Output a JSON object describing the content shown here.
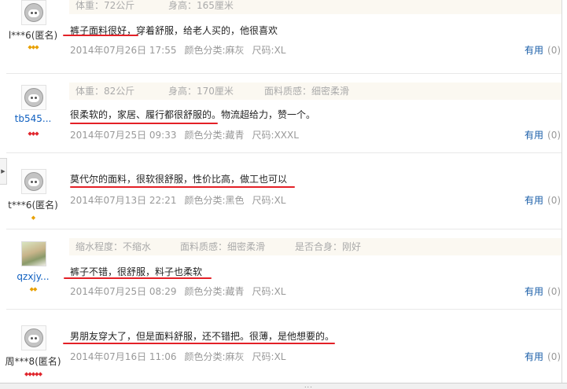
{
  "reviews": [
    {
      "user": "l***6(匿名)",
      "props": [
        "体重：72公斤",
        "身高：165厘米"
      ],
      "text": "裤子面料很好，穿着舒服，给老人买的，他很喜欢",
      "date": "2014年07月26日 17:55",
      "color": "颜色分类:麻灰",
      "size": "尺码:XL",
      "useful_label": "有用",
      "useful_count": "(0)",
      "level": "◆◆◆"
    },
    {
      "user": "tb545...",
      "props": [
        "体重：82公斤",
        "身高：170厘米",
        "面料质感：细密柔滑"
      ],
      "text": "很柔软的，家居、履行都很舒服的。物流超给力，赞一个。",
      "date": "2014年07月25日 09:33",
      "color": "颜色分类:藏青",
      "size": "尺码:XXXL",
      "useful_label": "有用",
      "useful_count": "(0)",
      "level": "◆◆◆"
    },
    {
      "user": "t***6(匿名)",
      "props": [],
      "text": "莫代尔的面料，很软很舒服，性价比高，做工也可以",
      "date": "2014年07月13日 22:21",
      "color": "颜色分类:黑色",
      "size": "尺码:XL",
      "useful_label": "有用",
      "useful_count": "(0)",
      "level": "◆"
    },
    {
      "user": "qzxjy...",
      "props": [
        "缩水程度：不缩水",
        "面料质感：细密柔滑",
        "是否合身：刚好"
      ],
      "text": "裤子不错，很舒服，料子也柔软",
      "date": "2014年07月25日 08:29",
      "color": "颜色分类:藏青",
      "size": "尺码:XL",
      "useful_label": "有用",
      "useful_count": "(0)",
      "level": "◆◆"
    },
    {
      "user": "周***8(匿名)",
      "props": [],
      "text": "男朋友穿大了，但是面料舒服，还不错把。很薄，是他想要的。",
      "date": "2014年07月16日 11:06",
      "color": "颜色分类:麻灰",
      "size": "尺码:XL",
      "useful_label": "有用",
      "useful_count": "(0)",
      "level": "◆◆◆◆◆"
    }
  ],
  "ui": {
    "left_toggle": "▶",
    "grip": "..."
  },
  "colors": {
    "link": "#1060c0",
    "underline": "#e32027",
    "meta": "#999999",
    "props_bg": "#fbf8f1"
  }
}
